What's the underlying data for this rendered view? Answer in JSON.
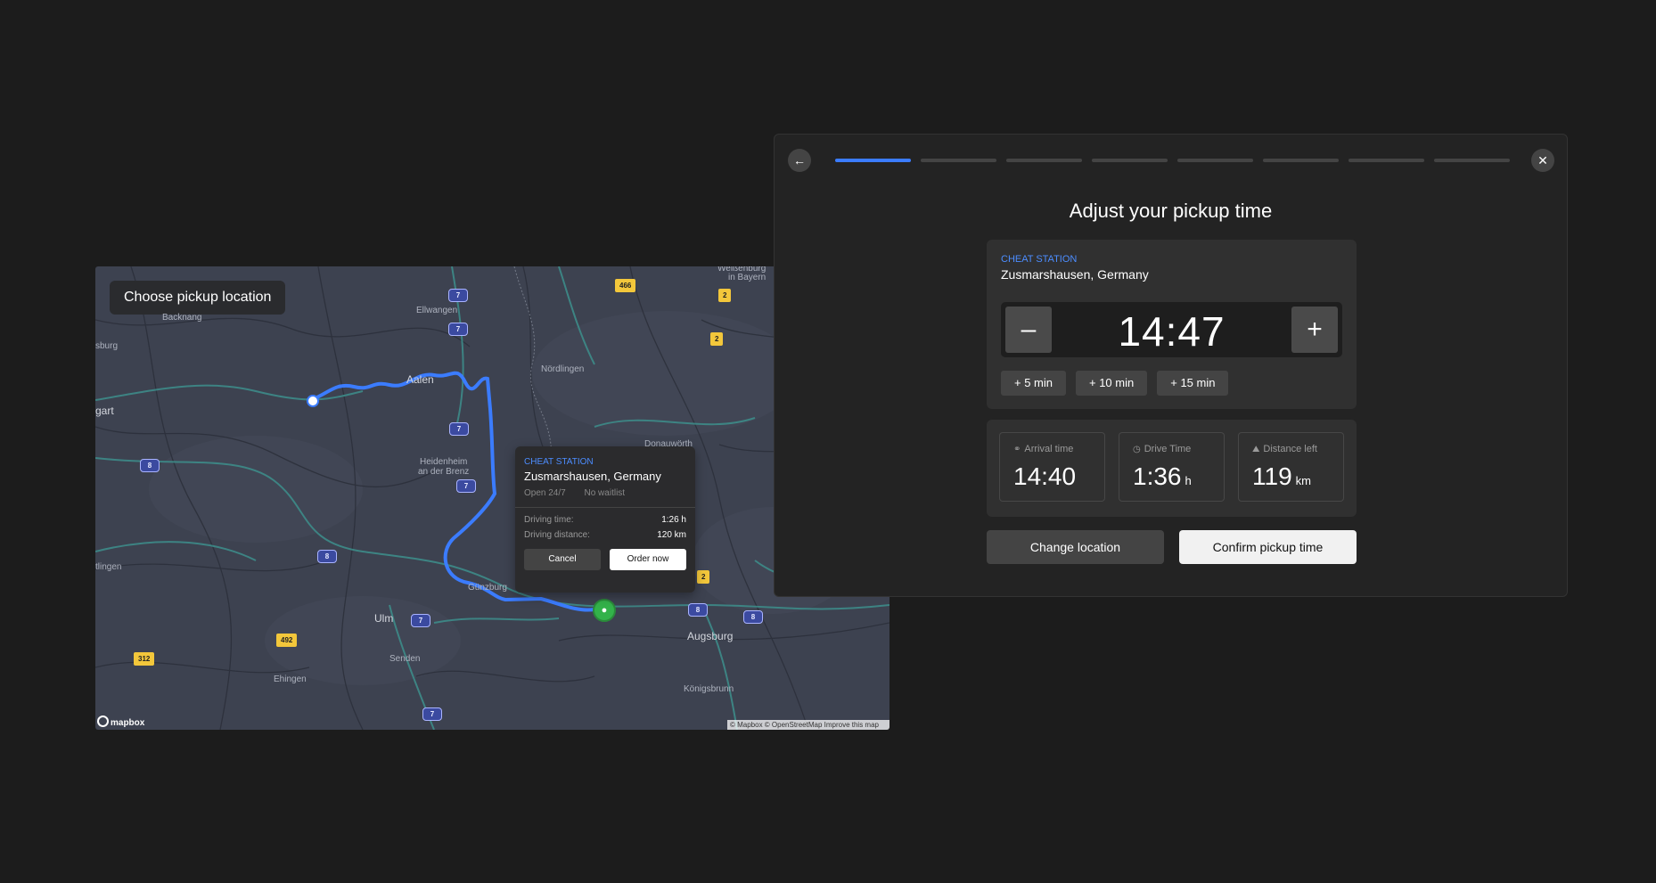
{
  "map": {
    "title": "Choose pickup location",
    "logo_text": "mapbox",
    "attribution": "© Mapbox © OpenStreetMap  Improve this map",
    "places": [
      {
        "name": "Ellwangen"
      },
      {
        "name": "Aalen",
        "big": true
      },
      {
        "name": "Nördlingen"
      },
      {
        "name": "Heidenheim"
      },
      {
        "name": "an der Brenz"
      },
      {
        "name": "Donauwörth"
      },
      {
        "name": "Weißenburg"
      },
      {
        "name": "in Bayern"
      },
      {
        "name": "Backnang"
      },
      {
        "name": "sburg"
      },
      {
        "name": "gart",
        "big": true
      },
      {
        "name": "tlingen"
      },
      {
        "name": "Ulm",
        "big": true
      },
      {
        "name": "Günzburg"
      },
      {
        "name": "Augsburg",
        "big": true
      },
      {
        "name": "Senden"
      },
      {
        "name": "Ehingen"
      },
      {
        "name": "Königsbrunn"
      }
    ],
    "shields": [
      "7",
      "7",
      "7",
      "7",
      "7",
      "7",
      "8",
      "8",
      "8",
      "8",
      "466",
      "2",
      "2",
      "2",
      "492",
      "312"
    ]
  },
  "popup": {
    "label": "CHEAT STATION",
    "location": "Zusmarshausen, Germany",
    "tags": [
      "Open 24/7",
      "No waitlist"
    ],
    "driving_time_label": "Driving time:",
    "driving_time_value": "1:26 h",
    "driving_distance_label": "Driving distance:",
    "driving_distance_value": "120 km",
    "cancel_label": "Cancel",
    "order_label": "Order now"
  },
  "dialog": {
    "progress": {
      "current": 1,
      "total": 8
    },
    "title": "Adjust your pickup time",
    "station_label": "CHEAT STATION",
    "station_location": "Zusmarshausen, Germany",
    "time": "14:47",
    "quick_adds": [
      "+ 5 min",
      "+ 10 min",
      "+ 15 min"
    ],
    "stats": [
      {
        "icon": "car-icon",
        "label": "Arrival time",
        "value": "14:40",
        "unit": ""
      },
      {
        "icon": "clock-icon",
        "label": "Drive Time",
        "value": "1:36",
        "unit": "h"
      },
      {
        "icon": "car-front-icon",
        "label": "Distance left",
        "value": "119",
        "unit": "km"
      }
    ],
    "change_label": "Change location",
    "confirm_label": "Confirm pickup time"
  },
  "colors": {
    "accent": "#3b7cff",
    "background": "#1c1c1c",
    "map_base": "#3d4250",
    "station_pin": "#33b24a",
    "highway_shield": "#f3c73b"
  }
}
